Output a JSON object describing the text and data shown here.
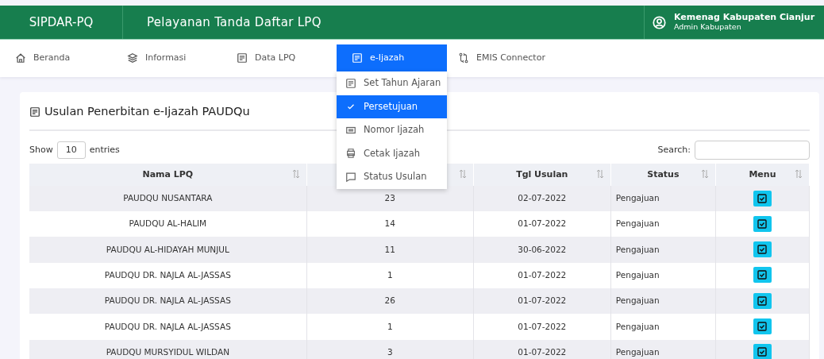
{
  "header": {
    "brand": "SIPDAR-PQ",
    "title": "Pelayanan Tanda Daftar LPQ",
    "user": {
      "name": "Kemenag Kabupaten Cianjur",
      "role": "Admin Kabupaten"
    }
  },
  "nav": [
    {
      "label": "Beranda",
      "selected": false
    },
    {
      "label": "Informasi",
      "selected": false
    },
    {
      "label": "Data LPQ",
      "selected": false
    },
    {
      "label": "e-Ijazah",
      "selected": true
    },
    {
      "label": "EMIS Connector",
      "selected": false
    }
  ],
  "dropdown": [
    {
      "label": "Set Tahun Ajaran",
      "selected": false
    },
    {
      "label": "Persetujuan",
      "selected": true
    },
    {
      "label": "Nomor Ijazah",
      "selected": false
    },
    {
      "label": "Cetak Ijazah",
      "selected": false
    },
    {
      "label": "Status Usulan",
      "selected": false
    }
  ],
  "card": {
    "title": "Usulan Penerbitan e-Ijazah PAUDQu",
    "length": {
      "before": "Show",
      "value": "10",
      "after": "entries"
    },
    "search_label": "Search:"
  },
  "table": {
    "columns": [
      {
        "label": "Nama LPQ"
      },
      {},
      {
        "label": "Tgl Usulan"
      },
      {
        "label": "Status"
      },
      {
        "label": "Menu"
      }
    ],
    "rows": [
      [
        "PAUDQU NUSANTARA",
        "23",
        "02-07-2022",
        "Pengajuan"
      ],
      [
        "PAUDQU AL-HALIM",
        "14",
        "01-07-2022",
        "Pengajuan"
      ],
      [
        "PAUDQU AL-HIDAYAH MUNJUL",
        "11",
        "30-06-2022",
        "Pengajuan"
      ],
      [
        "PAUDQU DR. NAJLA AL-JASSAS",
        "1",
        "01-07-2022",
        "Pengajuan"
      ],
      [
        "PAUDQU DR. NAJLA AL-JASSAS",
        "26",
        "01-07-2022",
        "Pengajuan"
      ],
      [
        "PAUDQU DR. NAJLA AL-JASSAS",
        "1",
        "01-07-2022",
        "Pengajuan"
      ],
      [
        "PAUDQU MURSYIDUL WILDAN",
        "3",
        "01-07-2022",
        "Pengajuan"
      ]
    ]
  }
}
